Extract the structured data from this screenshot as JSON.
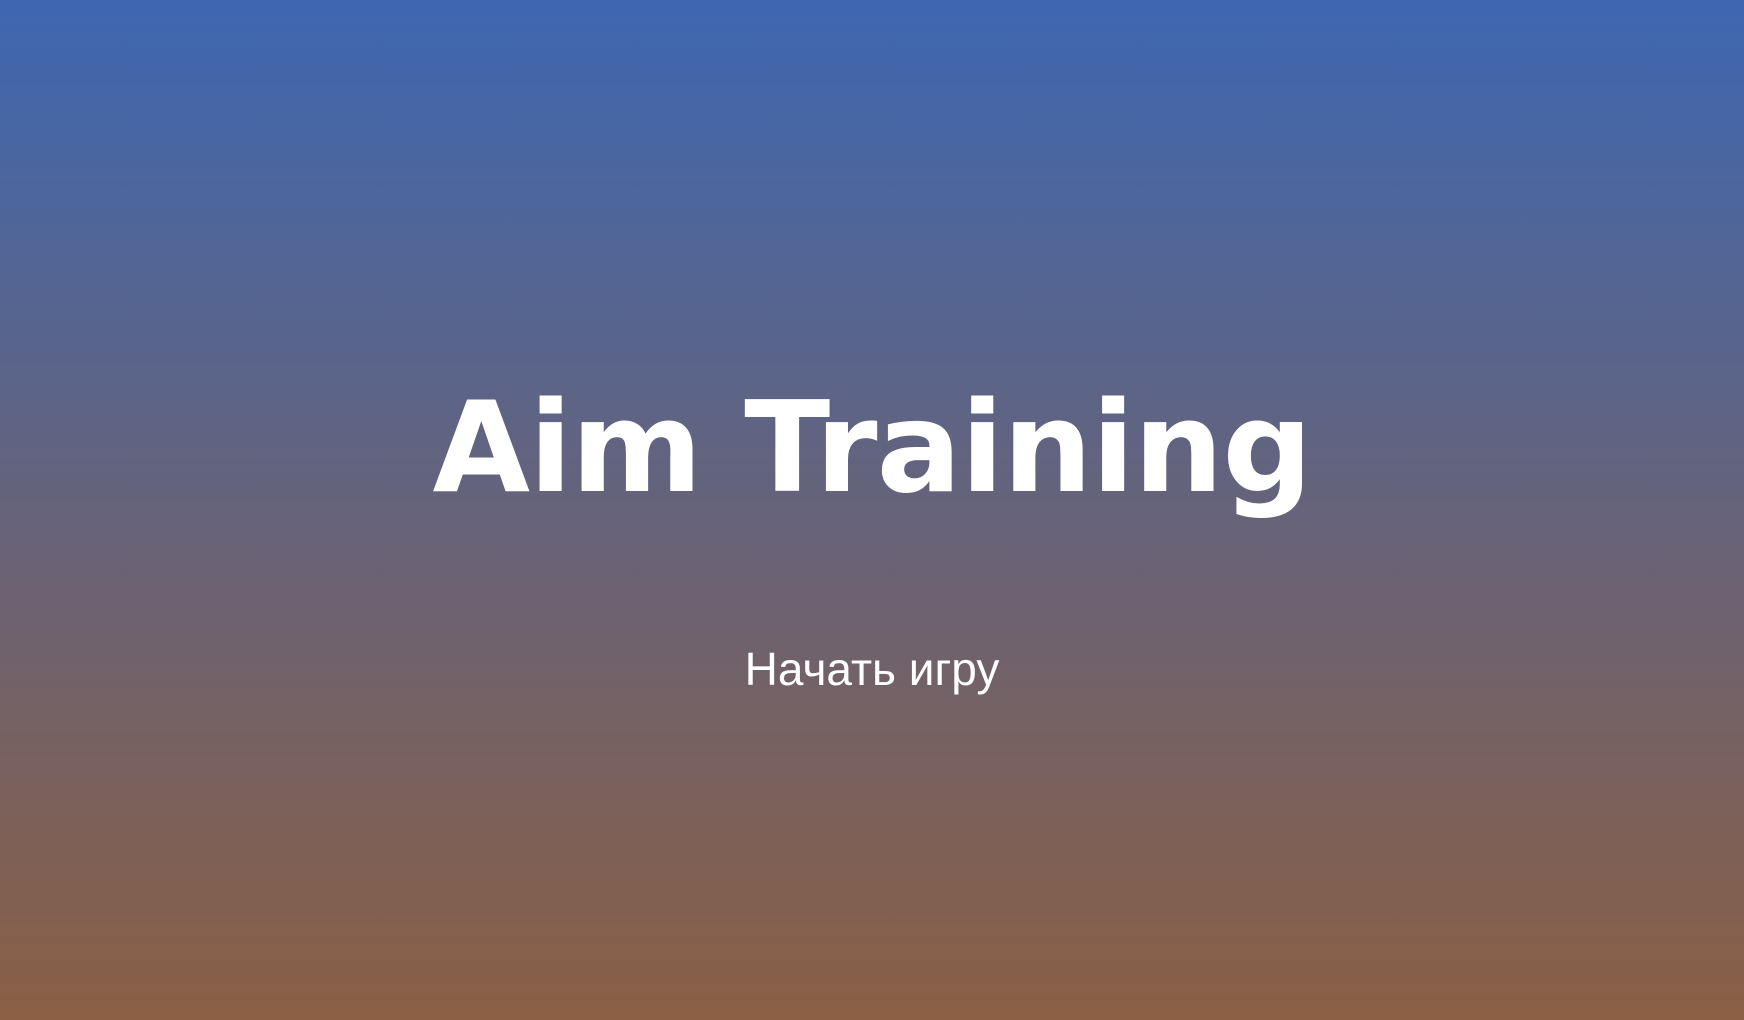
{
  "menu": {
    "title": "Aim Training",
    "start_label": "Начать игру"
  },
  "colors": {
    "gradient_top": "#3e67b1",
    "gradient_middle": "#66637a",
    "gradient_bottom": "#8a5f44",
    "text": "#ffffff"
  }
}
